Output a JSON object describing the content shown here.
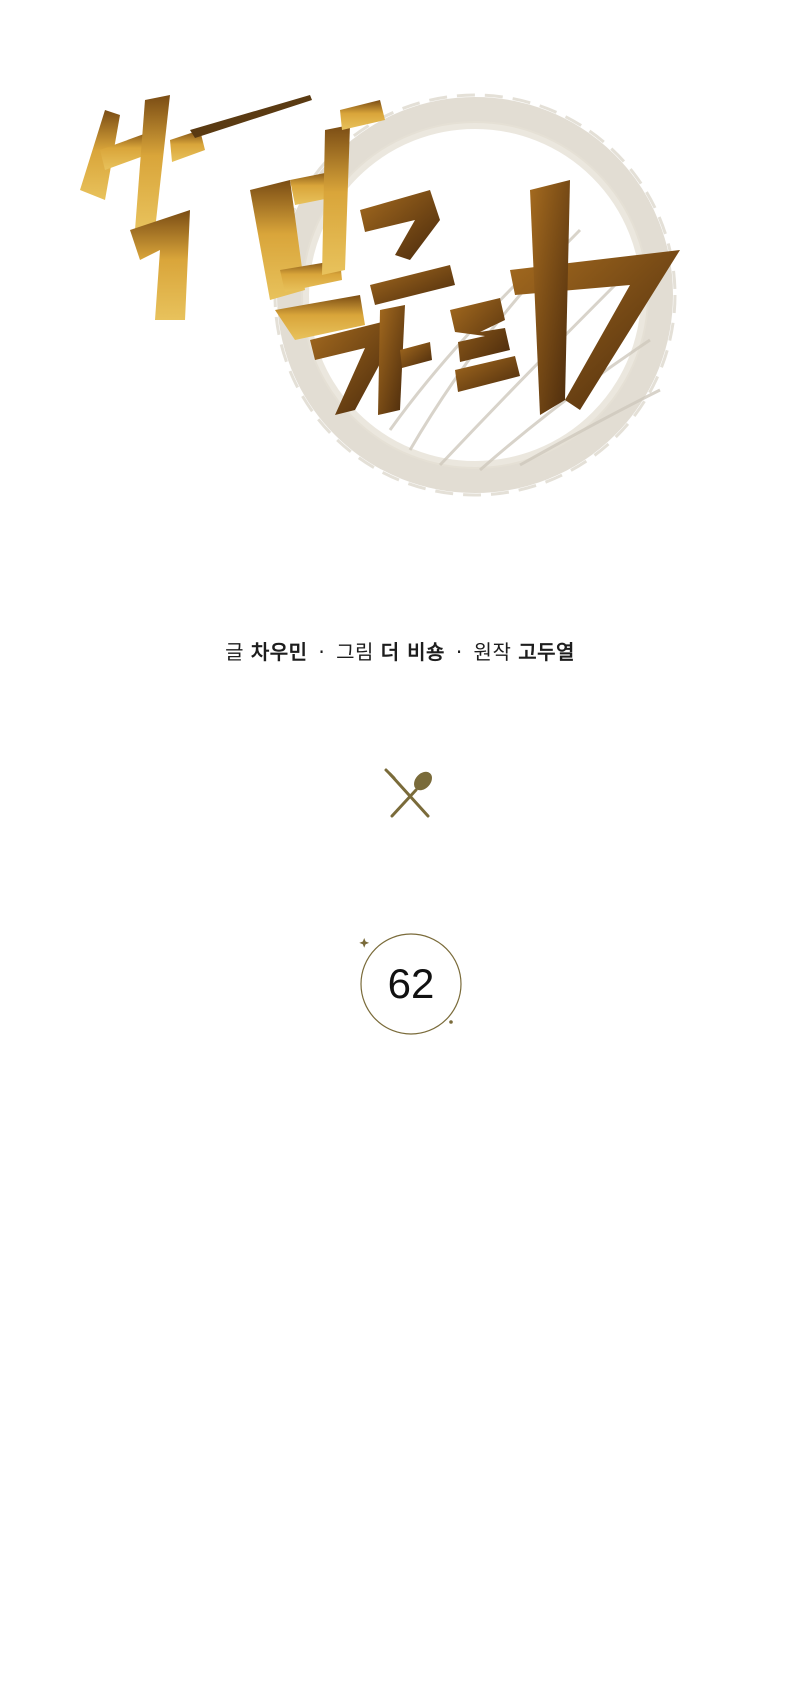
{
  "logo": {
    "text": "밥 먹고 가라",
    "icon": "calligraphy-logo-with-brush-circle",
    "colors": {
      "gold_light": "#d9a53a",
      "gold_dark": "#6e4412",
      "circle": "#cfc8b8"
    }
  },
  "credits": {
    "writer_role": "글",
    "writer_name": "차우민",
    "separator": "·",
    "artist_role": "그림",
    "artist_name": "더 비숑",
    "original_role": "원작",
    "original_name": "고두열"
  },
  "divider": {
    "icon": "fork-and-spoon-icon",
    "color": "#7a6b3a"
  },
  "chapter": {
    "number": "62"
  }
}
